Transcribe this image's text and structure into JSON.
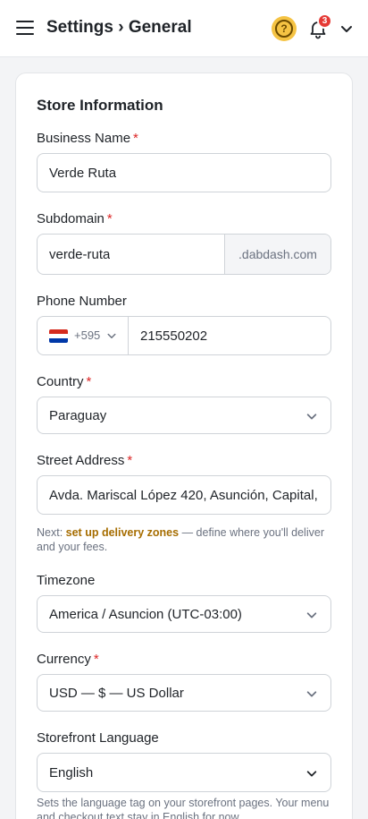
{
  "header": {
    "title": "Settings › General",
    "notification_count": "3"
  },
  "store": {
    "section_title": "Store Information",
    "business_name": {
      "label": "Business Name",
      "required": "*",
      "value": "Verde Ruta"
    },
    "subdomain": {
      "label": "Subdomain",
      "required": "*",
      "value": "verde-ruta",
      "suffix": ".dabdash.com"
    },
    "phone": {
      "label": "Phone Number",
      "dial_code": "+595",
      "value": "215550202"
    },
    "country": {
      "label": "Country",
      "required": "*",
      "value": "Paraguay"
    },
    "street": {
      "label": "Street Address",
      "required": "*",
      "value": "Avda. Mariscal López 420, Asunción, Capital,",
      "help_prefix": "Next: ",
      "help_link": "set up delivery zones",
      "help_suffix": " — define where you'll deliver and your fees."
    },
    "timezone": {
      "label": "Timezone",
      "value": "America / Asuncion (UTC-03:00)"
    },
    "currency": {
      "label": "Currency",
      "required": "*",
      "value": "USD — $ — US Dollar"
    },
    "language": {
      "label": "Storefront Language",
      "value": "English",
      "help": "Sets the language tag on your storefront pages. Your menu and checkout text stay in English for now."
    }
  },
  "colors": {
    "accent": "#f5c343",
    "link": "#a66d00",
    "required": "#dc2626",
    "badge": "#e53935",
    "flag_red": "#d52b1e",
    "flag_white": "#ffffff",
    "flag_blue": "#0038a8"
  },
  "icons": [
    "menu-icon",
    "help-circle-icon",
    "bell-icon",
    "chevron-down-icon",
    "paraguay-flag-icon"
  ]
}
